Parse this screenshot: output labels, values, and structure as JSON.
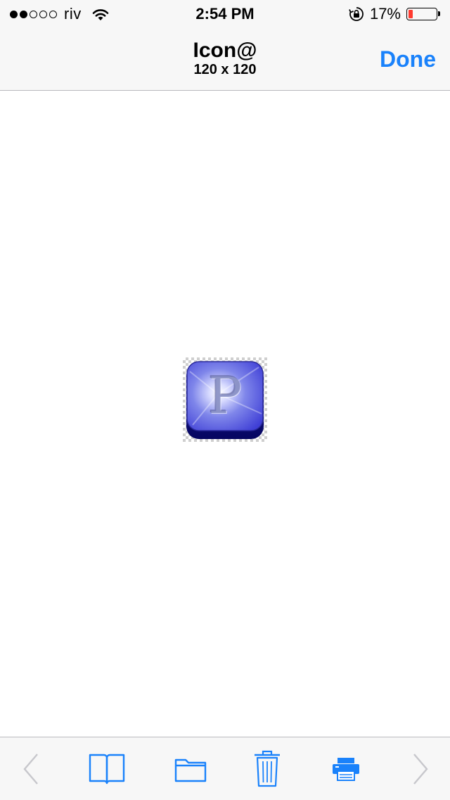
{
  "status_bar": {
    "signal_bars_filled": 2,
    "signal_bars_total": 5,
    "carrier": "riv",
    "time": "2:54 PM",
    "battery_percent_text": "17%",
    "battery_level": 0.17,
    "icons": [
      "wifi-icon",
      "orientation-lock-icon",
      "battery-icon"
    ]
  },
  "nav": {
    "title": "Icon@",
    "subtitle": "120 x 120",
    "done_label": "Done"
  },
  "preview": {
    "icon_letter": "P",
    "accent_color": "#3f3fd6"
  },
  "toolbar": {
    "items": [
      "back-chevron-icon",
      "book-icon",
      "folder-icon",
      "trash-icon",
      "printer-icon",
      "forward-chevron-icon"
    ]
  },
  "colors": {
    "tint": "#1a82fb",
    "disabled": "#c7c7cc",
    "battery_low": "#ff3b30"
  }
}
